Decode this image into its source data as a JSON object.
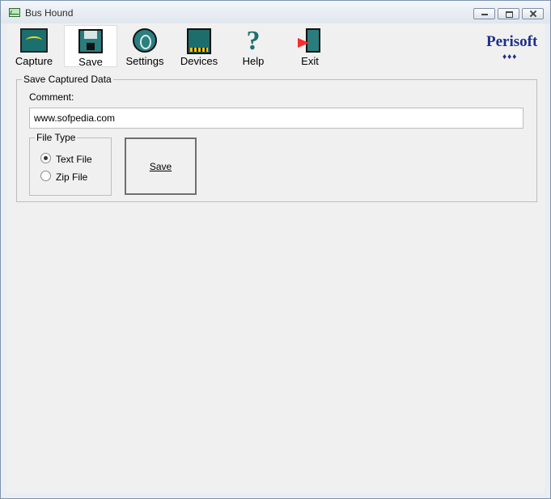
{
  "window": {
    "title": "Bus Hound"
  },
  "toolbar": {
    "items": [
      {
        "label": "Capture",
        "icon": "oscilloscope-icon"
      },
      {
        "label": "Save",
        "icon": "floppy-disk-icon",
        "active": true
      },
      {
        "label": "Settings",
        "icon": "dial-settings-icon"
      },
      {
        "label": "Devices",
        "icon": "chip-devices-icon"
      },
      {
        "label": "Help",
        "icon": "question-mark-icon"
      },
      {
        "label": "Exit",
        "icon": "exit-door-icon"
      }
    ]
  },
  "brand": {
    "name": "Perisoft",
    "dots": "♦♦♦"
  },
  "save_panel": {
    "group_title": "Save Captured Data",
    "comment_label": "Comment:",
    "comment_value": "www.sofpedia.com",
    "file_type": {
      "title": "File Type",
      "options": [
        {
          "label": "Text File",
          "selected": true
        },
        {
          "label": "Zip File",
          "selected": false
        }
      ]
    },
    "save_button_label": "Save"
  },
  "colors": {
    "accent": "#1e7070",
    "brand": "#1e2f88"
  }
}
